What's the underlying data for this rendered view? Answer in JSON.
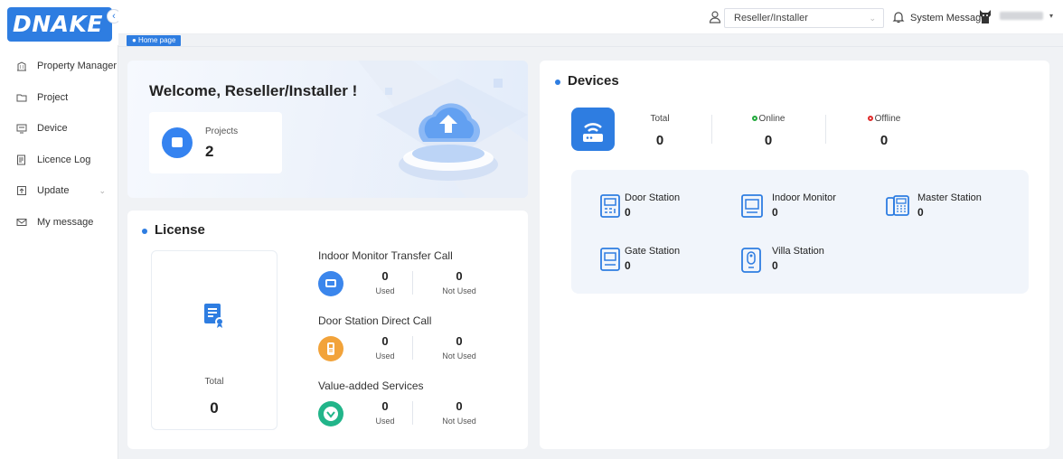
{
  "app": {
    "logo_text": "DNAKE",
    "collapse_glyph": "‹"
  },
  "sidebar": {
    "items": [
      {
        "label": "Property Manager",
        "icon": "building-icon"
      },
      {
        "label": "Project",
        "icon": "folder-icon"
      },
      {
        "label": "Device",
        "icon": "monitor-icon"
      },
      {
        "label": "Licence Log",
        "icon": "log-icon"
      },
      {
        "label": "Update",
        "icon": "upload-icon",
        "has_submenu": true
      },
      {
        "label": "My message",
        "icon": "mail-icon"
      }
    ]
  },
  "topbar": {
    "role_value": "Reseller/Installer",
    "system_message_label": "System Message"
  },
  "breadcrumb": {
    "label": "● Home page"
  },
  "welcome": {
    "title": "Welcome, Reseller/Installer !",
    "projects_label": "Projects",
    "projects_value": "2"
  },
  "license": {
    "title": "License",
    "total_label": "Total",
    "total_value": "0",
    "groups": [
      {
        "title": "Indoor Monitor Transfer Call",
        "used": "0",
        "used_label": "Used",
        "not_used": "0",
        "not_used_label": "Not Used",
        "icon_color": "#3b86ec",
        "icon": "monitor-icon"
      },
      {
        "title": "Door Station Direct Call",
        "used": "0",
        "used_label": "Used",
        "not_used": "0",
        "not_used_label": "Not Used",
        "icon_color": "#f2a33a",
        "icon": "door-station-icon"
      },
      {
        "title": "Value-added Services",
        "used": "0",
        "used_label": "Used",
        "not_used": "0",
        "not_used_label": "Not Used",
        "icon_color": "#22b58a",
        "icon": "diamond-icon"
      }
    ]
  },
  "devices": {
    "title": "Devices",
    "total_label": "Total",
    "total_value": "0",
    "online_label": "Online",
    "online_value": "0",
    "offline_label": "Offline",
    "offline_value": "0",
    "online_color": "#21a93c",
    "offline_color": "#e02a2a",
    "items": [
      {
        "name": "Door Station",
        "value": "0",
        "icon": "door-station-icon"
      },
      {
        "name": "Indoor Monitor",
        "value": "0",
        "icon": "indoor-monitor-icon"
      },
      {
        "name": "Master Station",
        "value": "0",
        "icon": "master-station-icon"
      },
      {
        "name": "Gate Station",
        "value": "0",
        "icon": "gate-station-icon"
      },
      {
        "name": "Villa Station",
        "value": "0",
        "icon": "villa-station-icon"
      }
    ]
  },
  "colors": {
    "accent": "#2e7de1"
  }
}
